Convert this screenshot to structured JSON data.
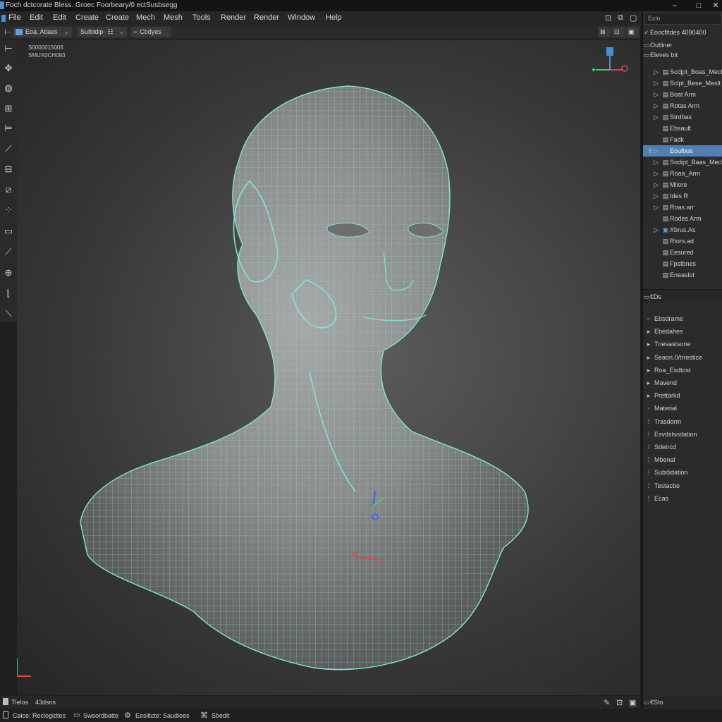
{
  "app": {
    "title": "Foch dctcorate Bless. Groec Foorbeary/0 ectSusbsegg"
  },
  "menu": [
    "File",
    "Edit",
    "Edit",
    "Create",
    "Create",
    "Mech",
    "Mesh",
    "Tools",
    "Render",
    "Render",
    "Window",
    "Help"
  ],
  "viewport_header": {
    "mode_label": "Eoa. Atlaes",
    "view_label": "Sulbtdip",
    "shading_label": "Cbdyes"
  },
  "viewport": {
    "overlay_line1": "S0000015006",
    "overlay_line2": "SMUX0CH093",
    "mesh_color": "#7fe6d4"
  },
  "toolbar": {
    "tools": [
      "select-tool-icon",
      "move-tool-icon",
      "rotate-tool-icon",
      "scale-tool-icon",
      "transform-tool-icon",
      "brush-tool-icon",
      "annotate-tool-icon",
      "measure-tool-icon",
      "loop-cut-icon",
      "knife-tool-icon",
      "poly-build-icon",
      "spin-tool-icon",
      "smooth-tool-icon",
      "shear-tool-icon"
    ]
  },
  "outliner": {
    "search_placeholder": "Eclo",
    "header_label": "Eoocfltdes 4090400",
    "title": "Outliner",
    "root_label": "Eleves bit",
    "items": [
      {
        "label": "Scdjpt_Boas_Mech",
        "tri": "▷",
        "ico": "▤",
        "selected": false
      },
      {
        "label": "Sclpt_Bese_Meslt",
        "tri": "▷",
        "ico": "▤",
        "selected": false
      },
      {
        "label": "Boat Arm",
        "tri": "▷",
        "ico": "▤",
        "selected": false
      },
      {
        "label": "Rotas Arm",
        "tri": "▷",
        "ico": "▤",
        "selected": false
      },
      {
        "label": "Strdbas",
        "tri": "▷",
        "ico": "▤",
        "selected": false
      },
      {
        "label": "Ebsault",
        "tri": "",
        "ico": "▤",
        "selected": false
      },
      {
        "label": "Fadk",
        "tri": "",
        "ico": "▤",
        "selected": false
      },
      {
        "label": "Eoulbos",
        "tri": "6 ▷",
        "ico": "",
        "selected": true
      },
      {
        "label": "Sodipt_Baas_Mech",
        "tri": "▷",
        "ico": "▤",
        "selected": false
      },
      {
        "label": "Roaa_Arm",
        "tri": "▷",
        "ico": "▤",
        "selected": false
      },
      {
        "label": "Mliore",
        "tri": "▷",
        "ico": "▤",
        "selected": false
      },
      {
        "label": "Ides R",
        "tri": "▷",
        "ico": "▤",
        "selected": false
      },
      {
        "label": "Roas.arr",
        "tri": "▷",
        "ico": "▤",
        "selected": false
      },
      {
        "label": "Rodes Arm",
        "tri": "",
        "ico": "▤",
        "selected": false
      },
      {
        "label": "Xbrus.As",
        "tri": "▷",
        "ico": "▣",
        "selected": false
      },
      {
        "label": "Rtors.ad",
        "tri": "",
        "ico": "▤",
        "selected": false
      },
      {
        "label": "Eesured",
        "tri": "",
        "ico": "▤",
        "selected": false
      },
      {
        "label": "Fpstbnes",
        "tri": "",
        "ico": "▤",
        "selected": false
      },
      {
        "label": "Eneaslot",
        "tri": "",
        "ico": "▤",
        "selected": false
      }
    ]
  },
  "properties": {
    "header_label": "€Ds",
    "rows": [
      {
        "tri": "−",
        "label": "Ebsdrame"
      },
      {
        "tri": "▸",
        "label": "Ebedahes"
      },
      {
        "tri": "▸",
        "label": "Tnesastsone"
      },
      {
        "tri": "▸",
        "label": "Seaon.0/trrestice"
      },
      {
        "tri": "▸",
        "label": "Roa_Esdtost"
      },
      {
        "tri": "▸",
        "label": "Mavend"
      },
      {
        "tri": "▸",
        "label": "Prettarkd"
      },
      {
        "tri": "◦",
        "label": "Material"
      },
      {
        "tri": "⁞",
        "label": "Trasdorm"
      },
      {
        "tri": "⁞",
        "label": "Esvdslsndation"
      },
      {
        "tri": "⁞",
        "label": "Sdetrcd"
      },
      {
        "tri": "⁞",
        "label": "Mbenal"
      },
      {
        "tri": "⁞",
        "label": "Subdidation"
      },
      {
        "tri": "⁞",
        "label": "Testacbe"
      },
      {
        "tri": "⁞",
        "label": "Ecas"
      }
    ],
    "footer": "€Sto"
  },
  "status": {
    "left_label1": "Tlelos",
    "left_label2": "43dsos",
    "item1": "Caice: Reclogidtes",
    "item2": "Swsordbatte",
    "item3": "Eeslitcte: Saudioes",
    "item4": "Sbedit"
  }
}
